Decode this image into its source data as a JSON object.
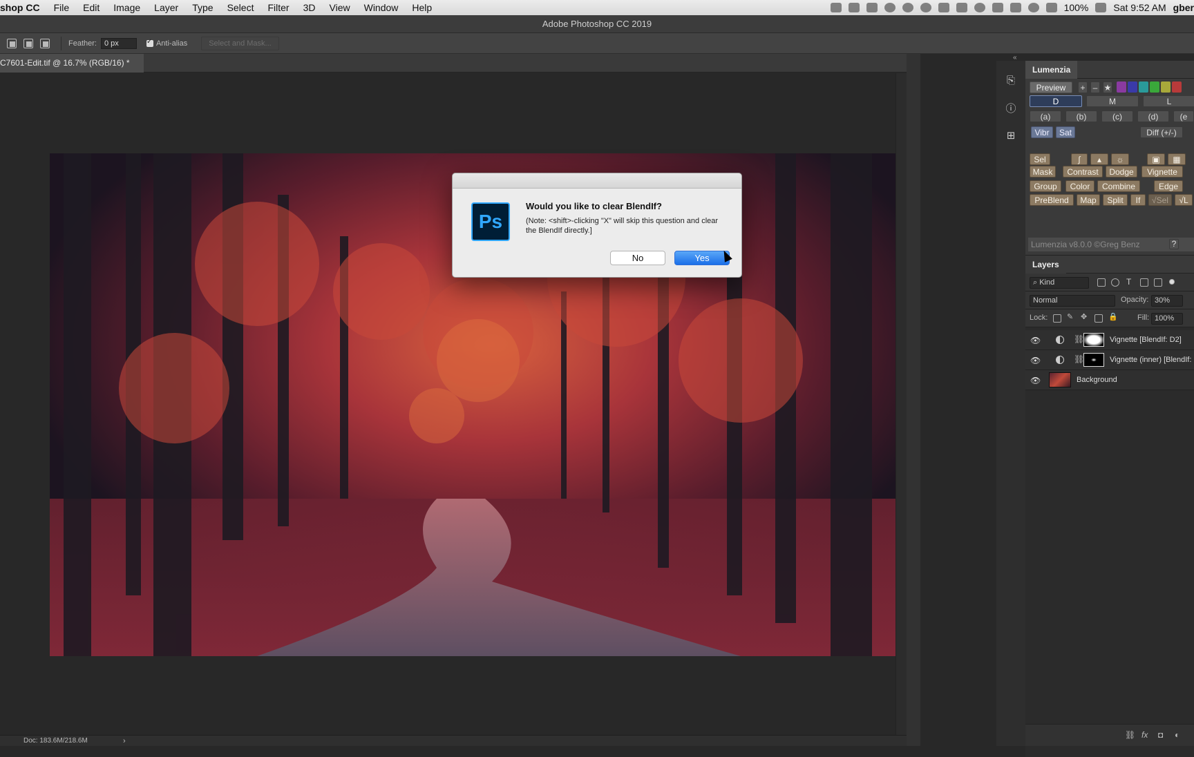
{
  "menubar": {
    "app_name": "shop CC",
    "items": [
      "File",
      "Edit",
      "Image",
      "Layer",
      "Type",
      "Select",
      "Filter",
      "3D",
      "View",
      "Window",
      "Help"
    ],
    "battery": "100%",
    "clock": "Sat 9:52 AM",
    "user": "gber"
  },
  "window": {
    "title": "Adobe Photoshop CC 2019"
  },
  "options": {
    "feather_label": "Feather:",
    "feather_value": "0 px",
    "antialias_label": "Anti-alias",
    "select_mask_label": "Select and Mask..."
  },
  "document": {
    "tab_label": "C7601-Edit.tif @ 16.7% (RGB/16) *"
  },
  "status": {
    "doc_info": "Doc: 183.6M/218.6M"
  },
  "dialog": {
    "title": "Would you like to clear BlendIf?",
    "note": "(Note: <shift>-clicking \"X\" will skip this question and clear the BlendIf directly.]",
    "no_label": "No",
    "yes_label": "Yes",
    "logo_text": "Ps"
  },
  "lumenzia": {
    "panel_title": "Lumenzia",
    "preview_label": "Preview",
    "plus": "+",
    "minus": "–",
    "star": "★",
    "zones": [
      "D",
      "M",
      "L"
    ],
    "letters": [
      "(a)",
      "(b)",
      "(c)",
      "(d)",
      "(e"
    ],
    "vibr": "Vibr",
    "sat": "Sat",
    "diff": "Diff (+/-)",
    "sel": "Sel",
    "row_mask": [
      "Mask",
      "Contrast",
      "Dodge",
      "Vignette"
    ],
    "row_group": [
      "Group",
      "Color",
      "Combine",
      "Edge"
    ],
    "row_preblend": [
      "PreBlend",
      "Map",
      "Split",
      "If",
      "√Sel",
      "√L"
    ],
    "footer": "Lumenzia v8.0.0 ©Greg Benz",
    "help": "?"
  },
  "layers": {
    "panel_title": "Layers",
    "kind_label": "Kind",
    "blend_mode": "Normal",
    "opacity_label": "Opacity:",
    "opacity_value": "30%",
    "lock_label": "Lock:",
    "fill_label": "Fill:",
    "fill_value": "100%",
    "items": [
      {
        "name": "Vignette [BlendIf: D2]"
      },
      {
        "name": "Vignette (inner) [BlendIf:"
      },
      {
        "name": "Background"
      }
    ]
  },
  "colors": {
    "accent": "#1b6fe8",
    "swatches": [
      "#8a3aa0",
      "#3a3aa8",
      "#2a9a9a",
      "#3aa83a",
      "#a8a83a",
      "#b83a3a"
    ]
  }
}
